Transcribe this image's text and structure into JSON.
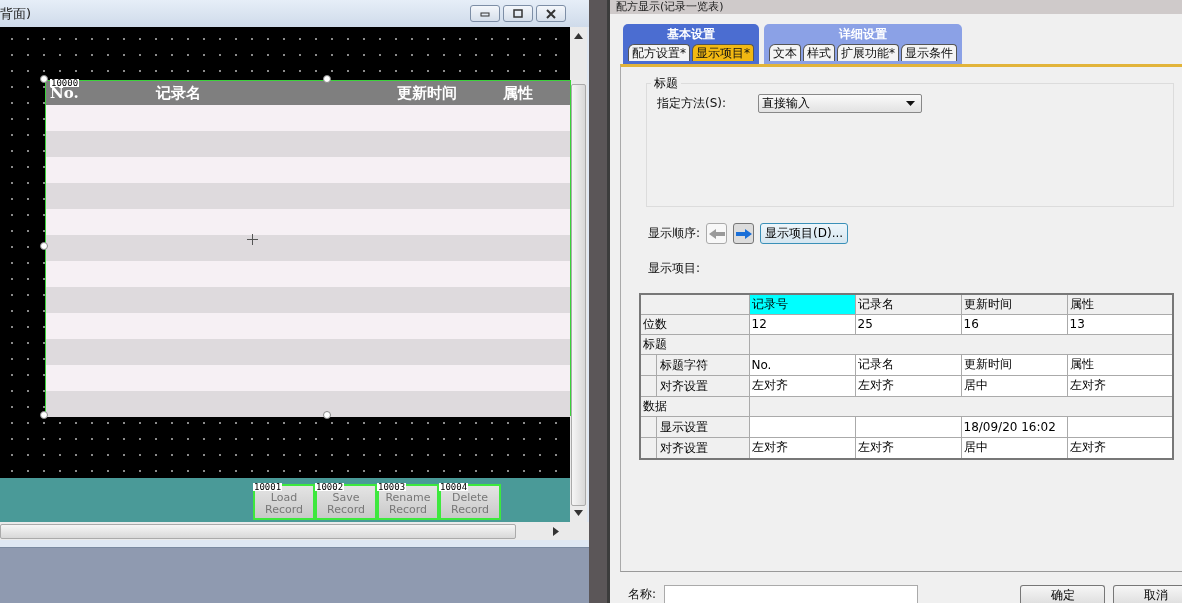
{
  "editor_window": {
    "title": "背面)",
    "widget": {
      "id_tag": "10000",
      "columns": [
        "No.",
        "记录名",
        "更新时间",
        "属性"
      ]
    },
    "buttons": [
      {
        "id_tag": "10001",
        "label": "Load Record"
      },
      {
        "id_tag": "10002",
        "label": "Save Record"
      },
      {
        "id_tag": "10003",
        "label": "Rename Record"
      },
      {
        "id_tag": "10004",
        "label": "Delete Record"
      }
    ]
  },
  "dialog": {
    "title": "配方显示(记录一览表)",
    "tab_groups": [
      {
        "label": "基本设置",
        "selected": true,
        "tabs": [
          {
            "label": "配方设置*",
            "selected": false
          },
          {
            "label": "显示项目*",
            "selected": true
          }
        ]
      },
      {
        "label": "详细设置",
        "selected": false,
        "tabs": [
          {
            "label": "文本",
            "selected": false
          },
          {
            "label": "样式",
            "selected": false
          },
          {
            "label": "扩展功能*",
            "selected": false
          },
          {
            "label": "显示条件",
            "selected": false
          }
        ]
      }
    ],
    "title_group": {
      "legend": "标题",
      "method_label": "指定方法(S):",
      "method_value": "直接输入"
    },
    "order_label": "显示顺序:",
    "order_buttons": [
      {
        "kind": "left",
        "disabled": true
      },
      {
        "kind": "right",
        "disabled": false
      }
    ],
    "items_button": "显示项目(D)...",
    "items_label": "显示项目:",
    "grid": {
      "columns": [
        {
          "label": "记录号",
          "selected": true
        },
        {
          "label": "记录名",
          "selected": false
        },
        {
          "label": "更新时间",
          "selected": false
        },
        {
          "label": "属性",
          "selected": false
        }
      ],
      "rows": [
        {
          "kind": "row",
          "label": "位数",
          "cells": [
            "12",
            "25",
            "16",
            "13"
          ]
        },
        {
          "kind": "section",
          "label": "标题"
        },
        {
          "kind": "sub",
          "label": "标题字符",
          "cells": [
            "No.",
            "记录名",
            "更新时间",
            "属性"
          ]
        },
        {
          "kind": "sub",
          "label": "对齐设置",
          "cells": [
            "左对齐",
            "左对齐",
            "居中",
            "左对齐"
          ]
        },
        {
          "kind": "section",
          "label": "数据"
        },
        {
          "kind": "sub",
          "label": "显示设置",
          "cells": [
            null,
            null,
            "18/09/20 16:02",
            null
          ]
        },
        {
          "kind": "sub",
          "label": "对齐设置",
          "cells": [
            "左对齐",
            "左对齐",
            "居中",
            "左对齐"
          ]
        }
      ]
    },
    "name_label": "名称:",
    "ok_button": "确定",
    "cancel_button": "取消"
  }
}
